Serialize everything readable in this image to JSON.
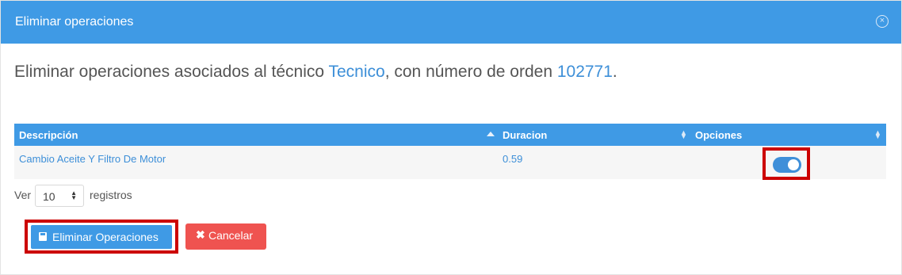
{
  "modal": {
    "title": "Eliminar operaciones",
    "close_glyph": "×"
  },
  "intro": {
    "prefix": "Eliminar operaciones asociados al técnico ",
    "technician": "Tecnico",
    "middle": ", con número de orden ",
    "order_number": "102771",
    "suffix": "."
  },
  "table": {
    "columns": [
      "Descripción",
      "Duracion",
      "Opciones"
    ],
    "rows": [
      {
        "descripcion": "Cambio Aceite Y Filtro De Motor",
        "duracion": "0.59",
        "enabled": true
      }
    ]
  },
  "pager": {
    "prefix": "Ver",
    "value": "10",
    "suffix": "registros"
  },
  "buttons": {
    "delete_label": "Eliminar Operaciones",
    "cancel_label": "Cancelar"
  },
  "colors": {
    "header": "#3f9ae5",
    "danger": "#ef5350",
    "highlight": "#cc0000",
    "link": "#3d8fd8"
  }
}
